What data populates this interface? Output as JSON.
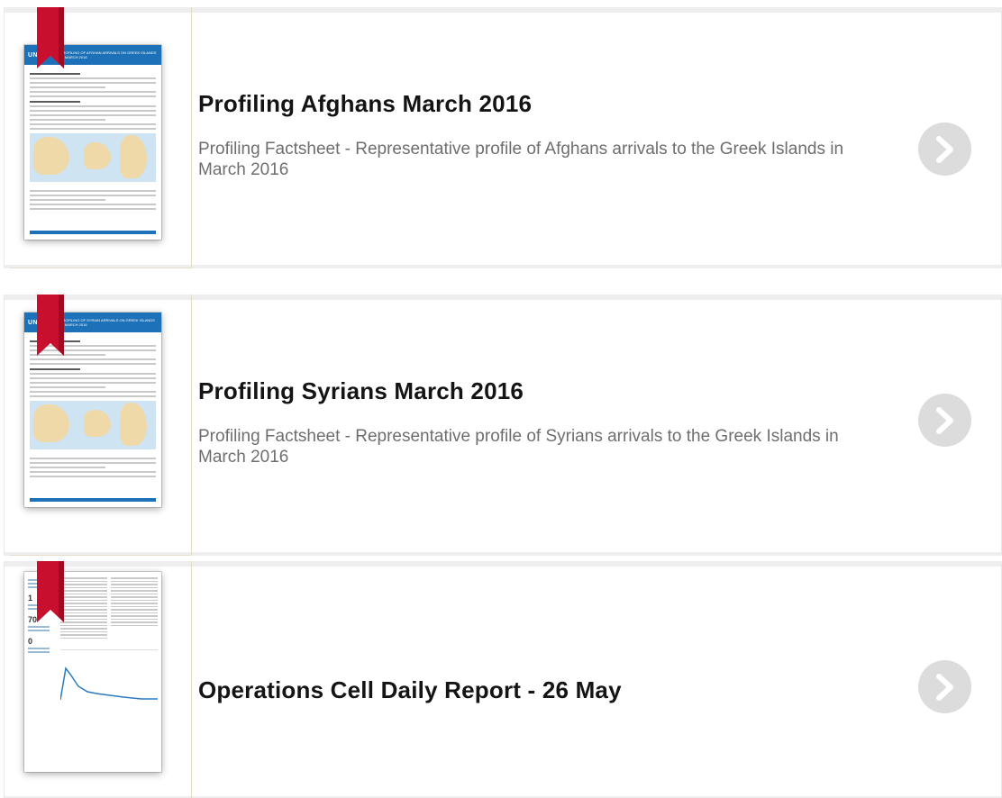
{
  "items": [
    {
      "title": "Profiling Afghans March 2016",
      "description": "Profiling Factsheet - Representative profile of Afghans arrivals to the Greek Islands in March 2016",
      "thumbnail": {
        "logo": "UNHCR",
        "heading": "PROFILING OF AFGHAN ARRIVALS ON GREEK ISLANDS IN MARCH 2016"
      }
    },
    {
      "title": "Profiling Syrians March 2016",
      "description": "Profiling Factsheet - Representative profile of Syrians arrivals to the Greek Islands in March 2016",
      "thumbnail": {
        "logo": "UNHCR",
        "heading": "PROFILING OF SYRIAN ARRIVALS ON GREEK ISLANDS IN MARCH 2016"
      }
    },
    {
      "title": "Operations Cell Daily Report - 26 May",
      "description": "",
      "thumbnail": {
        "stat1": "1",
        "stat2": "70",
        "stat3": "0"
      }
    }
  ],
  "colors": {
    "ribbon": "#c8102e",
    "unhcr_blue": "#1d71b8",
    "arrow_button": "#dcdcdc",
    "divider": "#e3dcc6"
  },
  "icons": {
    "bookmark": "bookmark-ribbon-icon",
    "next": "chevron-right-icon"
  }
}
